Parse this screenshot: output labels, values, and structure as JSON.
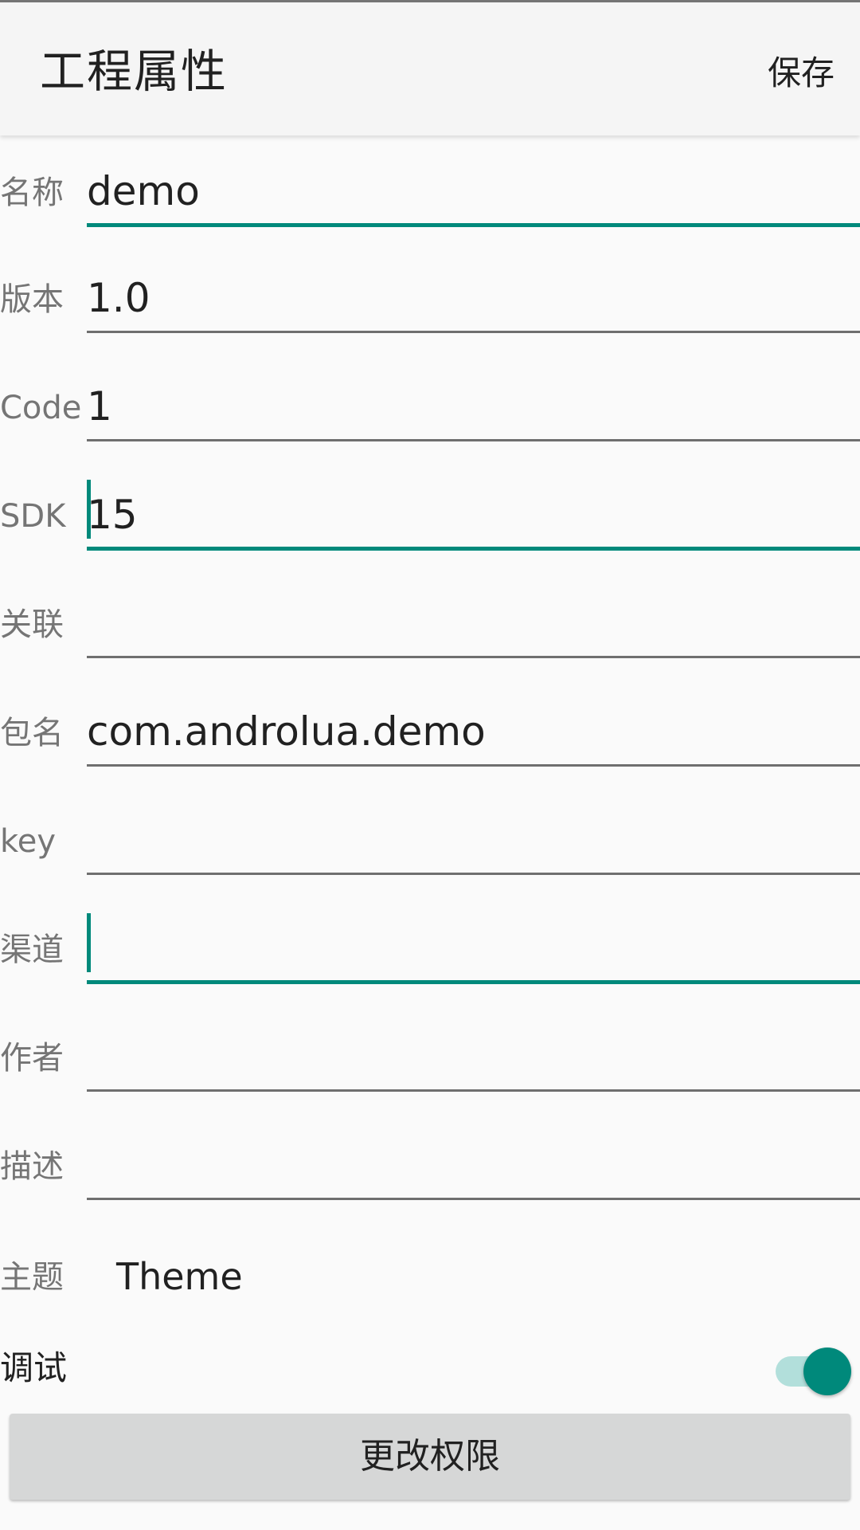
{
  "header": {
    "title": "工程属性",
    "save_label": "保存"
  },
  "fields": [
    {
      "label": "名称",
      "value": "demo",
      "focused": true,
      "cursor": false
    },
    {
      "label": "版本",
      "value": "1.0",
      "focused": false,
      "cursor": false
    },
    {
      "label": "Code",
      "value": "1",
      "focused": false,
      "cursor": false
    },
    {
      "label": "SDK",
      "value": "15",
      "focused": true,
      "cursor": true
    },
    {
      "label": "关联",
      "value": "",
      "focused": false,
      "cursor": false
    },
    {
      "label": "包名",
      "value": "com.androlua.demo",
      "focused": false,
      "cursor": false
    },
    {
      "label": "key",
      "value": "",
      "focused": false,
      "cursor": false
    },
    {
      "label": "渠道",
      "value": "",
      "focused": true,
      "cursor": true
    },
    {
      "label": "作者",
      "value": "",
      "focused": false,
      "cursor": false
    },
    {
      "label": "描述",
      "value": "",
      "focused": false,
      "cursor": false
    }
  ],
  "theme": {
    "label": "主题",
    "value": "Theme"
  },
  "debug": {
    "label": "调试",
    "enabled": true
  },
  "permission_button_label": "更改权限",
  "colors": {
    "accent": "#00897b",
    "accent_light": "#b2dfdb",
    "app_bar": "#f5f5f5",
    "background": "#fafafa"
  }
}
